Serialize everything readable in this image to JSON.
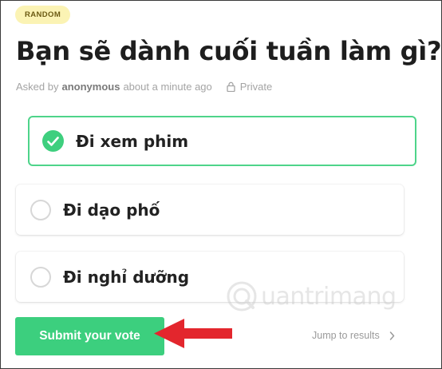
{
  "badge": "RANDOM",
  "question": "Bạn sẽ dành cuối tuần làm gì?",
  "meta": {
    "asked_by_prefix": "Asked by",
    "author": "anonymous",
    "time": "about a minute ago",
    "visibility": "Private",
    "visibility_icon": "lock-icon"
  },
  "options": [
    {
      "label": "Đi xem phim",
      "selected": true
    },
    {
      "label": "Đi dạo phố",
      "selected": false
    },
    {
      "label": "Đi nghỉ dưỡng",
      "selected": false
    }
  ],
  "submit_label": "Submit your vote",
  "jump_label": "Jump to results",
  "watermark_text": "uantrimang",
  "colors": {
    "accent_green": "#3ccf7e",
    "badge_bg": "#fbf3b4",
    "annotation_arrow": "#e3262d"
  }
}
